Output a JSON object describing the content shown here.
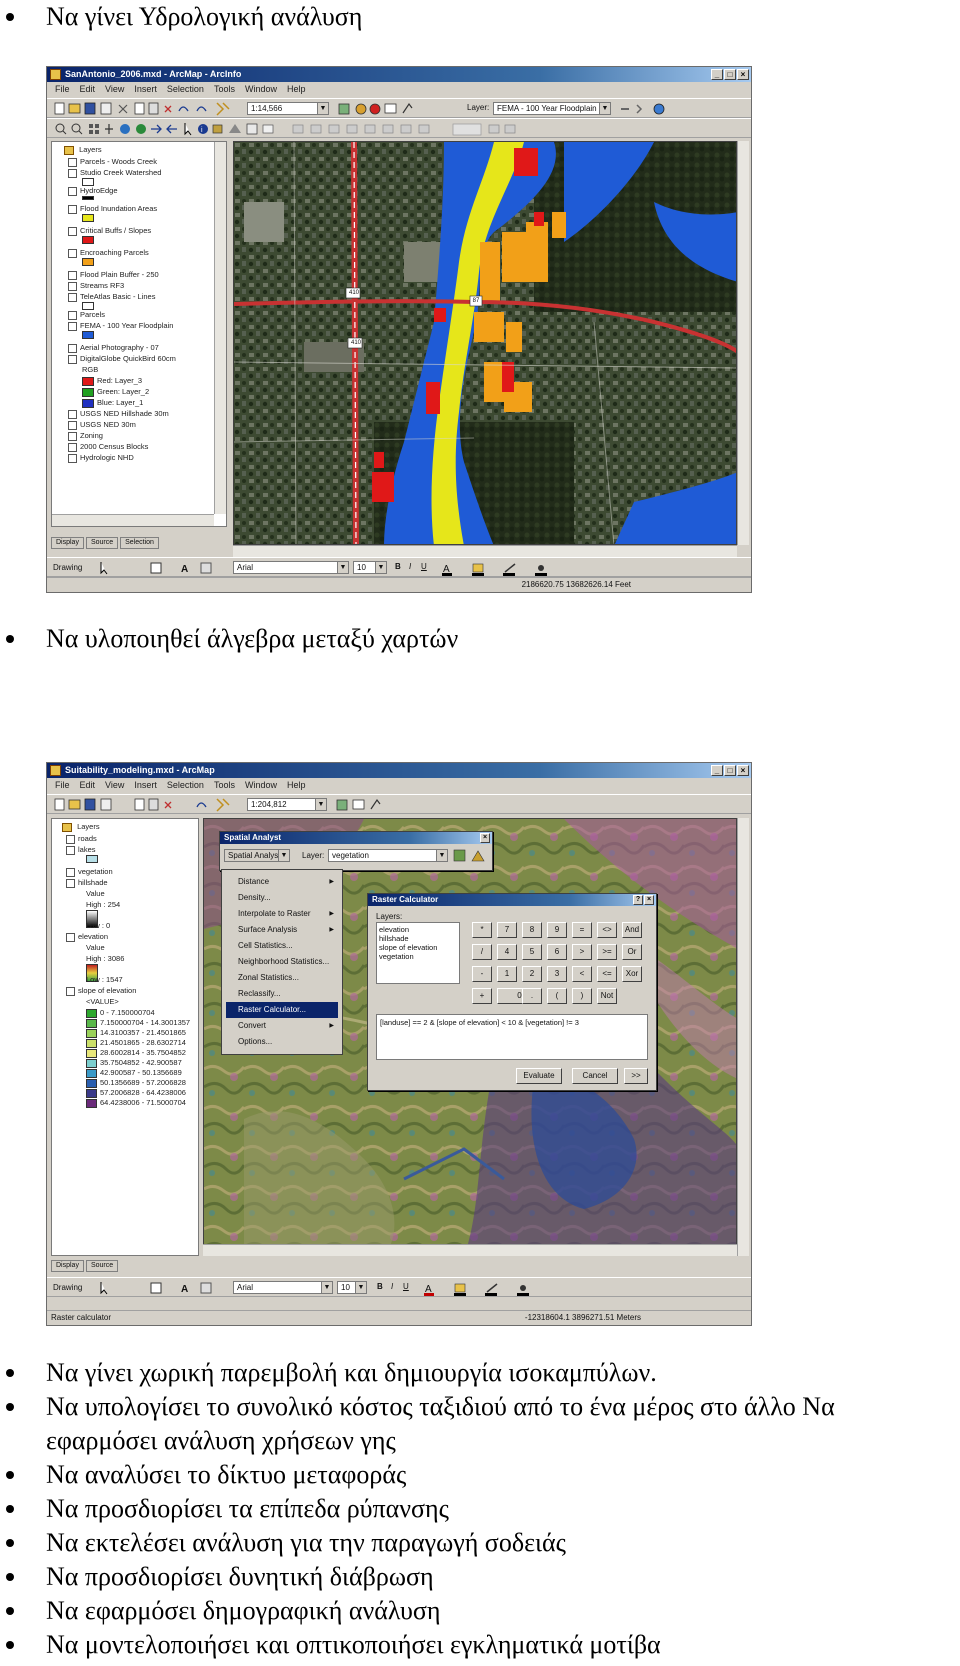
{
  "bullets_top": {
    "item1": "Να γίνει Υδρολογική ανάλυση"
  },
  "bullets_mid": {
    "item2": "Να υλοποιηθεί άλγεβρα μεταξύ χαρτών"
  },
  "bullets_bottom": [
    "Να γίνει χωρική παρεμβολή και δημιουργία ισοκαμπύλων.",
    "Να υπολογίσει το συνολικό κόστος ταξιδιού από το ένα μέρος στο άλλο Να",
    "εφαρμόσει ανάλυση χρήσεων γης",
    "Να αναλύσει το δίκτυο μεταφοράς",
    "Να προσδιορίσει τα επίπεδα ρύπανσης",
    "Να εκτελέσει ανάλυση για την παραγωγή σοδειάς",
    "Να προσδιορίσει δυνητική διάβρωση",
    "Να εφαρμόσει δημογραφική ανάλυση",
    "Να μοντελοποιήσει και οπτικοποιήσει εγκληματικά μοτίβα"
  ],
  "screenshot1": {
    "title": "SanAntonio_2006.mxd - ArcMap - ArcInfo",
    "menus": [
      "File",
      "Edit",
      "View",
      "Insert",
      "Selection",
      "Tools",
      "Window",
      "Help"
    ],
    "scale": "1:14,566",
    "layer_label": "Layer:",
    "layer_value": "FEMA - 100 Year Floodplain",
    "toc_header": "Layers",
    "toc_items": [
      "Parcels - Woods Creek",
      "Studio Creek Watershed",
      "HydroEdge",
      "Flood Inundation Areas",
      "Critical Buffs / Slopes",
      "Encroaching Parcels",
      "Flood Plain Buffer - 250",
      "Streams RF3",
      "TeleAtlas Basic - Lines",
      "Parcels",
      "FEMA - 100 Year Floodplain",
      "Aerial Photography - 07",
      "DigitalGlobe QuickBird 60cm",
      "RGB",
      "Red: Layer_3",
      "Green: Layer_2",
      "Blue: Layer_1",
      "USGS NED Hillshade 30m",
      "USGS NED 30m",
      "Zoning",
      "2000 Census Blocks",
      "Hydrologic NHD"
    ],
    "tabs": [
      "Display",
      "Source",
      "Selection"
    ],
    "drawing_label": "Drawing",
    "font_value": "Arial",
    "font_size": "10",
    "status_text": "2186620.75  13682626.14 Feet",
    "road_labels": [
      "410",
      "87",
      "410"
    ],
    "colors": {
      "flood_blue": "#1f5bd6",
      "flood_yellow": "#e6e61a",
      "parcel_orange": "#f2a018",
      "parcel_red": "#e01818",
      "road_red": "#c83232"
    }
  },
  "screenshot2": {
    "title": "Suitability_modeling.mxd - ArcMap",
    "menus": [
      "File",
      "Edit",
      "View",
      "Insert",
      "Selection",
      "Tools",
      "Window",
      "Help"
    ],
    "scale": "1:204,812",
    "toc_header": "Layers",
    "toc_items": [
      "roads",
      "lakes",
      "vegetation",
      "hillshade",
      "Value",
      "High : 254",
      "Low : 0",
      "elevation",
      "Value",
      "High : 3086",
      "Low : 1547",
      "slope of elevation",
      "<VALUE>"
    ],
    "slope_classes": [
      "0 - 7.150000704",
      "7.150000704 - 14.3001357",
      "14.3100357 - 21.4501865",
      "21.4501865 - 28.6302714",
      "28.6002814 - 35.7504852",
      "35.7504852 - 42.900587",
      "42.900587 - 50.1356689",
      "50.1356689 - 57.2006828",
      "57.2006828 - 64.4238006",
      "64.4238006 - 71.5000704"
    ],
    "slope_colors": [
      "#2ea82e",
      "#5ab84a",
      "#9bd25a",
      "#cce06a",
      "#e9e77a",
      "#7ccfcf",
      "#3a9ac8",
      "#2a5fb0",
      "#3a3a8a",
      "#6a2a7a"
    ],
    "tabs": [
      "Display",
      "Source"
    ],
    "spatial_analyst": {
      "title": "Spatial Analyst",
      "dropdown": "Spatial Analyst",
      "layer_label": "Layer:",
      "layer_value": "vegetation",
      "menu_items": [
        "Distance",
        "Density...",
        "Interpolate to Raster",
        "Surface Analysis",
        "Cell Statistics...",
        "Neighborhood Statistics...",
        "Zonal Statistics...",
        "Reclassify...",
        "Raster Calculator...",
        "Convert",
        "Options..."
      ],
      "selected_index": 8
    },
    "raster_calc": {
      "title": "Raster Calculator",
      "layers_label": "Layers:",
      "layers": [
        "elevation",
        "hillshade",
        "slope of elevation",
        "vegetation"
      ],
      "keypad": [
        "*",
        "7",
        "8",
        "9",
        "=",
        "<>",
        "And",
        "/",
        "4",
        "5",
        "6",
        ">",
        ">=",
        "Or",
        "-",
        "1",
        "2",
        "3",
        "<",
        "<=",
        "Xor",
        "+",
        "0",
        ".",
        "(",
        ")",
        "Not"
      ],
      "expression": "[landuse] == 2 & [slope of elevation] < 10 & [vegetation] != 3",
      "evaluate": "Evaluate",
      "cancel": "Cancel",
      "more": ">>"
    },
    "drawing_label": "Drawing",
    "font_value": "Arial",
    "font_size": "10",
    "status_left": "Raster calculator",
    "status_right": "-12318604.1  3896271.51 Meters"
  }
}
